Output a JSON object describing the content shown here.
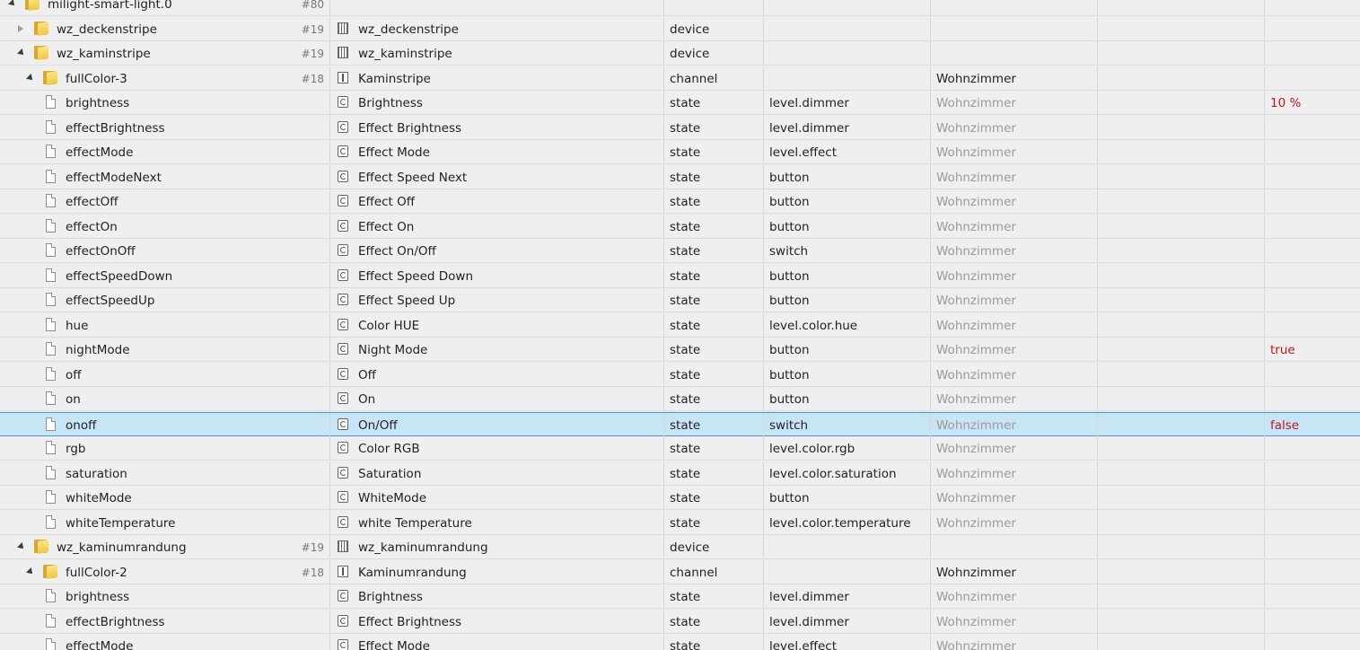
{
  "rows": [
    {
      "id": "milight-smart-light.0",
      "count": "#80",
      "name": "",
      "type": "",
      "role": "",
      "room": "",
      "value": "",
      "level": 0,
      "kind": "folder",
      "toggle": "open",
      "nameIcon": "top"
    },
    {
      "id": "wz_deckenstripe",
      "count": "#19",
      "name": "wz_deckenstripe",
      "type": "device",
      "role": "",
      "room": "",
      "value": "",
      "level": 1,
      "kind": "folder",
      "toggle": "closed",
      "nameIcon": "dev"
    },
    {
      "id": "wz_kaminstripe",
      "count": "#19",
      "name": "wz_kaminstripe",
      "type": "device",
      "role": "",
      "room": "",
      "value": "",
      "level": 1,
      "kind": "folder",
      "toggle": "open",
      "nameIcon": "dev"
    },
    {
      "id": "fullColor-3",
      "count": "#18",
      "name": "Kaminstripe",
      "type": "channel",
      "role": "",
      "room": "Wohnzimmer",
      "value": "",
      "level": 2,
      "kind": "folder",
      "toggle": "open",
      "nameIcon": "chan",
      "roomDark": true
    },
    {
      "id": "brightness",
      "name": "Brightness",
      "type": "state",
      "role": "level.dimmer",
      "room": "Wohnzimmer",
      "value": "10 %",
      "level": 3,
      "kind": "file",
      "nameIcon": "state"
    },
    {
      "id": "effectBrightness",
      "name": "Effect Brightness",
      "type": "state",
      "role": "level.dimmer",
      "room": "Wohnzimmer",
      "value": "",
      "level": 3,
      "kind": "file",
      "nameIcon": "state"
    },
    {
      "id": "effectMode",
      "name": "Effect Mode",
      "type": "state",
      "role": "level.effect",
      "room": "Wohnzimmer",
      "value": "",
      "level": 3,
      "kind": "file",
      "nameIcon": "state"
    },
    {
      "id": "effectModeNext",
      "name": "Effect Speed Next",
      "type": "state",
      "role": "button",
      "room": "Wohnzimmer",
      "value": "",
      "level": 3,
      "kind": "file",
      "nameIcon": "state"
    },
    {
      "id": "effectOff",
      "name": "Effect Off",
      "type": "state",
      "role": "button",
      "room": "Wohnzimmer",
      "value": "",
      "level": 3,
      "kind": "file",
      "nameIcon": "state"
    },
    {
      "id": "effectOn",
      "name": "Effect On",
      "type": "state",
      "role": "button",
      "room": "Wohnzimmer",
      "value": "",
      "level": 3,
      "kind": "file",
      "nameIcon": "state"
    },
    {
      "id": "effectOnOff",
      "name": "Effect On/Off",
      "type": "state",
      "role": "switch",
      "room": "Wohnzimmer",
      "value": "",
      "level": 3,
      "kind": "file",
      "nameIcon": "state"
    },
    {
      "id": "effectSpeedDown",
      "name": "Effect Speed Down",
      "type": "state",
      "role": "button",
      "room": "Wohnzimmer",
      "value": "",
      "level": 3,
      "kind": "file",
      "nameIcon": "state"
    },
    {
      "id": "effectSpeedUp",
      "name": "Effect Speed Up",
      "type": "state",
      "role": "button",
      "room": "Wohnzimmer",
      "value": "",
      "level": 3,
      "kind": "file",
      "nameIcon": "state"
    },
    {
      "id": "hue",
      "name": "Color HUE",
      "type": "state",
      "role": "level.color.hue",
      "room": "Wohnzimmer",
      "value": "",
      "level": 3,
      "kind": "file",
      "nameIcon": "state"
    },
    {
      "id": "nightMode",
      "name": "Night Mode",
      "type": "state",
      "role": "button",
      "room": "Wohnzimmer",
      "value": "true",
      "level": 3,
      "kind": "file",
      "nameIcon": "state"
    },
    {
      "id": "off",
      "name": "Off",
      "type": "state",
      "role": "button",
      "room": "Wohnzimmer",
      "value": "",
      "level": 3,
      "kind": "file",
      "nameIcon": "state"
    },
    {
      "id": "on",
      "name": "On",
      "type": "state",
      "role": "button",
      "room": "Wohnzimmer",
      "value": "",
      "level": 3,
      "kind": "file",
      "nameIcon": "state"
    },
    {
      "id": "onoff",
      "name": "On/Off",
      "type": "state",
      "role": "switch",
      "room": "Wohnzimmer",
      "value": "false",
      "level": 3,
      "kind": "file",
      "nameIcon": "state",
      "selected": true
    },
    {
      "id": "rgb",
      "name": "Color RGB",
      "type": "state",
      "role": "level.color.rgb",
      "room": "Wohnzimmer",
      "value": "",
      "level": 3,
      "kind": "file",
      "nameIcon": "state"
    },
    {
      "id": "saturation",
      "name": "Saturation",
      "type": "state",
      "role": "level.color.saturation",
      "room": "Wohnzimmer",
      "value": "",
      "level": 3,
      "kind": "file",
      "nameIcon": "state"
    },
    {
      "id": "whiteMode",
      "name": "WhiteMode",
      "type": "state",
      "role": "button",
      "room": "Wohnzimmer",
      "value": "",
      "level": 3,
      "kind": "file",
      "nameIcon": "state"
    },
    {
      "id": "whiteTemperature",
      "name": "white Temperature",
      "type": "state",
      "role": "level.color.temperature",
      "room": "Wohnzimmer",
      "value": "",
      "level": 3,
      "kind": "file",
      "nameIcon": "state"
    },
    {
      "id": "wz_kaminumrandung",
      "count": "#19",
      "name": "wz_kaminumrandung",
      "type": "device",
      "role": "",
      "room": "",
      "value": "",
      "level": 1,
      "kind": "folder",
      "toggle": "open",
      "nameIcon": "dev"
    },
    {
      "id": "fullColor-2",
      "count": "#18",
      "name": "Kaminumrandung",
      "type": "channel",
      "role": "",
      "room": "Wohnzimmer",
      "value": "",
      "level": 2,
      "kind": "folder",
      "toggle": "open",
      "nameIcon": "chan",
      "roomDark": true
    },
    {
      "id": "brightness",
      "name": "Brightness",
      "type": "state",
      "role": "level.dimmer",
      "room": "Wohnzimmer",
      "value": "",
      "level": 3,
      "kind": "file",
      "nameIcon": "state"
    },
    {
      "id": "effectBrightness",
      "name": "Effect Brightness",
      "type": "state",
      "role": "level.dimmer",
      "room": "Wohnzimmer",
      "value": "",
      "level": 3,
      "kind": "file",
      "nameIcon": "state"
    },
    {
      "id": "effectMode",
      "name": "Effect Mode",
      "type": "state",
      "role": "level.effect",
      "room": "Wohnzimmer",
      "value": "",
      "level": 3,
      "kind": "file",
      "nameIcon": "state"
    }
  ]
}
